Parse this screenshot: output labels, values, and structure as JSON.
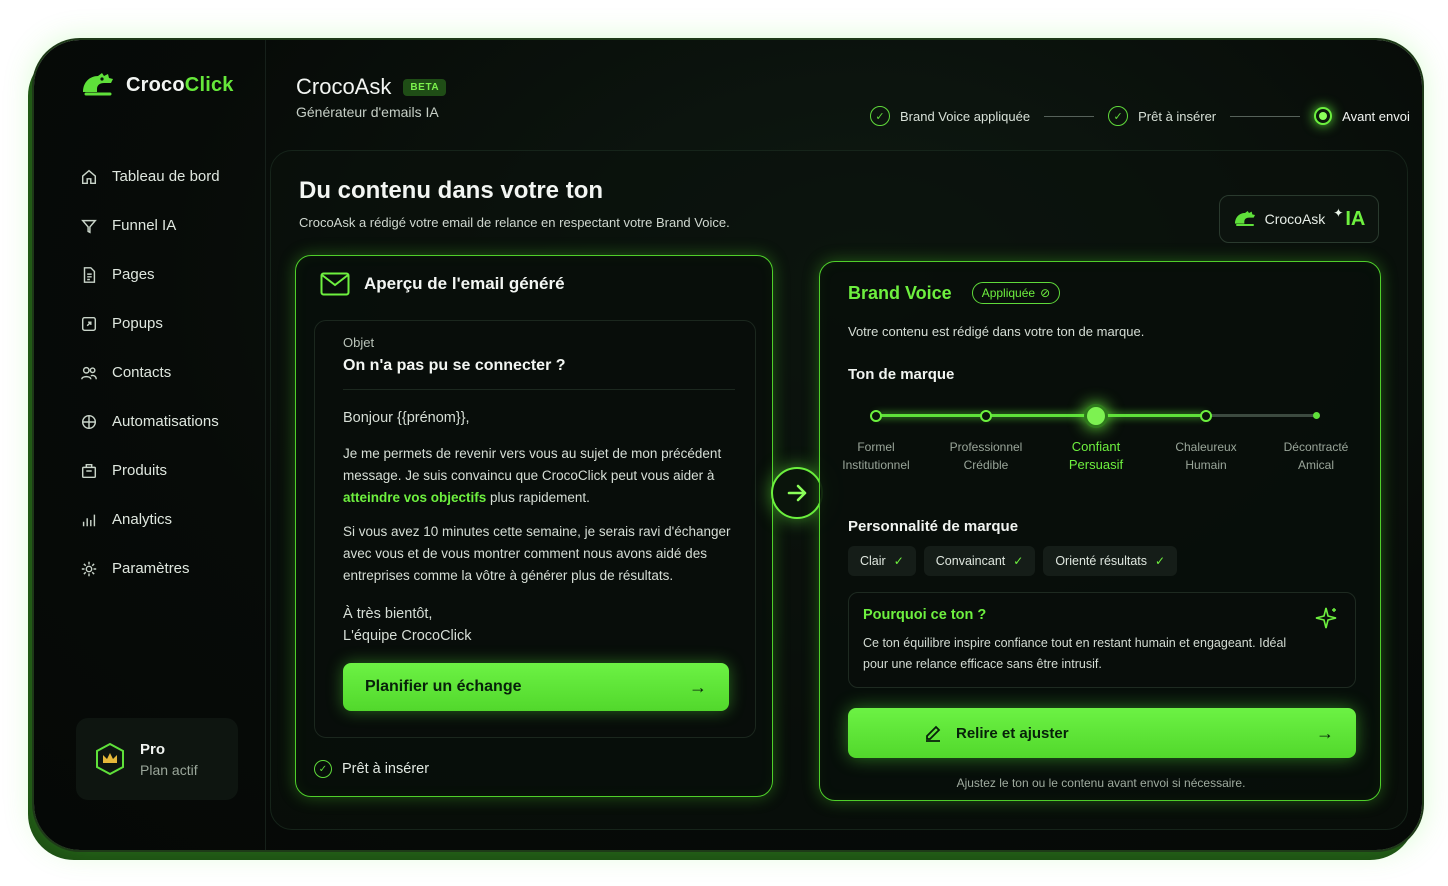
{
  "app": {
    "brand_prefix": "Croco",
    "brand_accent": "Click"
  },
  "sidebar": {
    "items": [
      {
        "label": "Tableau de bord",
        "icon": "home-icon"
      },
      {
        "label": "Funnel IA",
        "icon": "funnel-icon"
      },
      {
        "label": "Pages",
        "icon": "page-icon"
      },
      {
        "label": "Popups",
        "icon": "popup-icon"
      },
      {
        "label": "Contacts",
        "icon": "contacts-icon"
      },
      {
        "label": "Automatisations",
        "icon": "automation-icon"
      },
      {
        "label": "Produits",
        "icon": "products-icon"
      },
      {
        "label": "Analytics",
        "icon": "analytics-icon"
      },
      {
        "label": "Paramètres",
        "icon": "gear-icon"
      }
    ],
    "plan": {
      "name": "Pro",
      "status": "Plan actif"
    }
  },
  "header": {
    "title": "CrocoAsk",
    "badge": "BETA",
    "subtitle": "Générateur d'emails IA",
    "steps": [
      {
        "label": "Brand Voice appliquée",
        "state": "done"
      },
      {
        "label": "Prêt à insérer",
        "state": "done"
      },
      {
        "label": "Avant envoi",
        "state": "current"
      }
    ]
  },
  "main": {
    "title": "Du contenu dans votre ton",
    "subtitle": "CrocoAsk a rédigé votre email de relance en respectant votre Brand Voice.",
    "ai_badge": {
      "name": "CrocoAsk",
      "suffix": "IA"
    }
  },
  "email": {
    "card_title": "Aperçu de l'email généré",
    "subject_label": "Objet",
    "subject": "On n'a pas pu se connecter ?",
    "greeting": "Bonjour {{prénom}},",
    "p1_before": "Je me permets de revenir vers vous au sujet de mon précédent message. Je suis convaincu que CrocoClick peut vous aider à ",
    "p1_highlight": "atteindre vos objectifs",
    "p1_after": " plus rapidement.",
    "p2": "Si vous avez 10 minutes cette semaine, je serais ravi d'échanger avec vous et de vous montrer comment nous avons aidé des entreprises comme la vôtre à générer plus de résultats.",
    "signoff": "À très bientôt,",
    "signature": "L'équipe CrocoClick",
    "cta_label": "Planifier un échange",
    "ready_label": "Prêt à insérer"
  },
  "brand_voice": {
    "title": "Brand Voice",
    "badge": "Appliquée",
    "description": "Votre contenu est rédigé dans votre ton de marque.",
    "tone_title": "Ton de marque",
    "tone_selected_index": 2,
    "tones": [
      {
        "line1": "Formel",
        "line2": "Institutionnel"
      },
      {
        "line1": "Professionnel",
        "line2": "Crédible"
      },
      {
        "line1": "Confiant",
        "line2": "Persuasif"
      },
      {
        "line1": "Chaleureux",
        "line2": "Humain"
      },
      {
        "line1": "Décontracté",
        "line2": "Amical"
      }
    ],
    "personality_title": "Personnalité de marque",
    "traits": [
      "Clair",
      "Convaincant",
      "Orienté résultats"
    ],
    "why_title": "Pourquoi ce ton ?",
    "why_text": "Ce ton équilibre inspire confiance tout en restant humain et engageant. Idéal pour une relance efficace sans être intrusif.",
    "cta_label": "Relire et ajuster",
    "note": "Ajustez le ton ou le contenu avant envoi si nécessaire."
  },
  "colors": {
    "accent": "#66e83a",
    "background": "#070b08",
    "card_border": "#4fcf2a"
  }
}
